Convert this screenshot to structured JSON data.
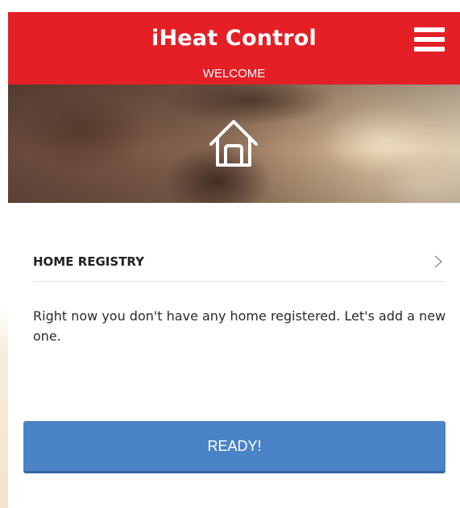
{
  "header": {
    "title": "iHeat Control",
    "subtitle": "WELCOME",
    "menu_icon": "hamburger-menu-icon",
    "background_color": "#e41f26"
  },
  "hero": {
    "icon": "home-icon"
  },
  "home_registry": {
    "title": "HOME REGISTRY",
    "chevron_icon": "chevron-right-icon",
    "message": "Right now you don't have any home registered. Let's add a new one."
  },
  "actions": {
    "ready_label": "READY!",
    "ready_color": "#4a84c6"
  }
}
